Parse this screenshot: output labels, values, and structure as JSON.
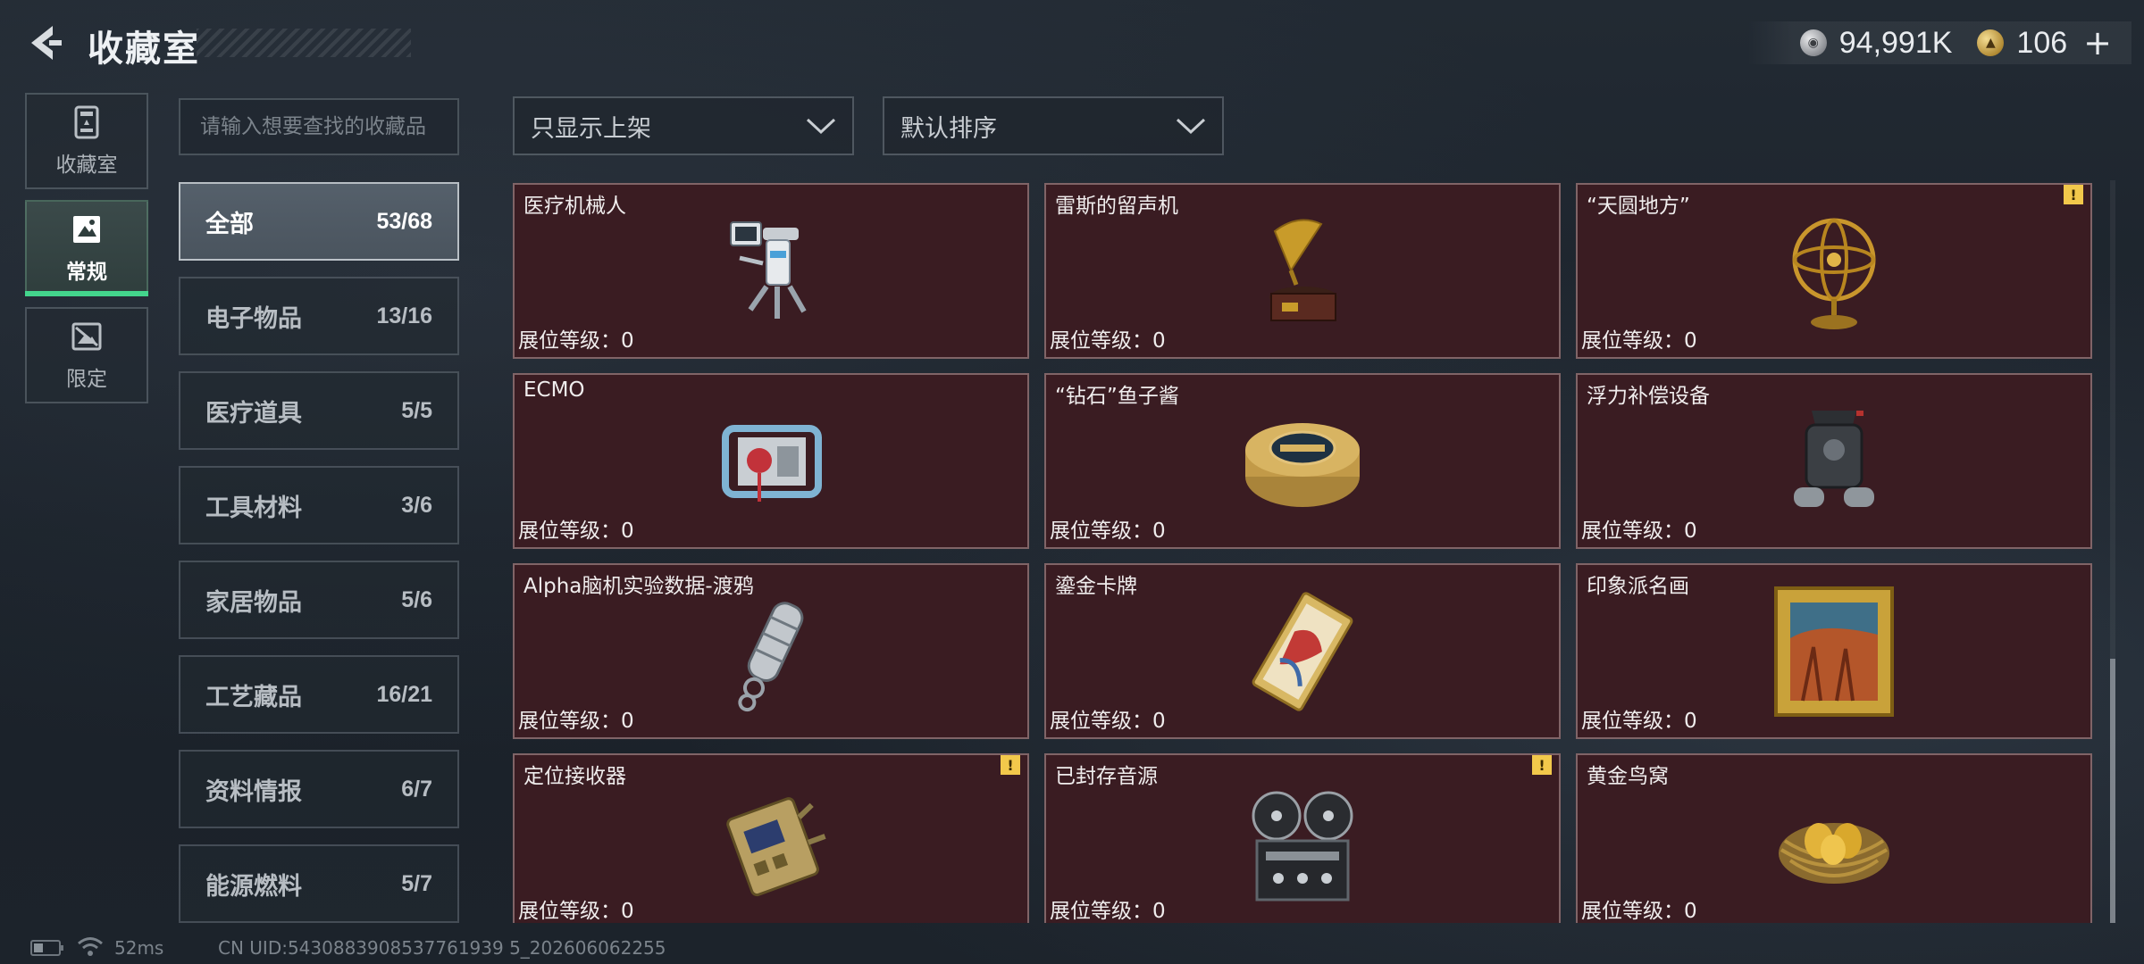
{
  "header": {
    "title": "收藏室",
    "currencies": [
      {
        "icon": "silver-coin-icon",
        "value": "94,991K"
      },
      {
        "icon": "gold-coin-icon",
        "value": "106"
      }
    ],
    "add_label": "+"
  },
  "left_nav": [
    {
      "label": "收藏室",
      "icon": "collection-room-icon",
      "active": false
    },
    {
      "label": "常规",
      "icon": "regular-items-icon",
      "active": true
    },
    {
      "label": "限定",
      "icon": "limited-items-icon",
      "active": false
    }
  ],
  "search": {
    "placeholder": "请输入想要查找的收藏品"
  },
  "categories": [
    {
      "name": "全部",
      "count": "53/68",
      "active": true
    },
    {
      "name": "电子物品",
      "count": "13/16"
    },
    {
      "name": "医疗道具",
      "count": "5/5"
    },
    {
      "name": "工具材料",
      "count": "3/6"
    },
    {
      "name": "家居物品",
      "count": "5/6"
    },
    {
      "name": "工艺藏品",
      "count": "16/21"
    },
    {
      "name": "资料情报",
      "count": "6/7"
    },
    {
      "name": "能源燃料",
      "count": "5/7"
    }
  ],
  "filters": {
    "shelf_filter": "只显示上架",
    "sort": "默认排序"
  },
  "level_label": "展位等级：0",
  "items": [
    {
      "name": "",
      "icon": "item-icon",
      "warn": false
    },
    {
      "name": "",
      "icon": "item-icon",
      "warn": false
    },
    {
      "name": "",
      "icon": "item-icon",
      "warn": false
    },
    {
      "name": "医疗机械人",
      "icon": "medical-robot-icon",
      "warn": false
    },
    {
      "name": "雷斯的留声机",
      "icon": "gramophone-icon",
      "warn": false
    },
    {
      "name": "“天圆地方”",
      "icon": "armillary-sphere-icon",
      "warn": true
    },
    {
      "name": "ECMO",
      "icon": "ecmo-machine-icon",
      "warn": false
    },
    {
      "name": "“钻石”鱼子酱",
      "icon": "caviar-tin-icon",
      "warn": false
    },
    {
      "name": "浮力补偿设备",
      "icon": "buoyancy-device-icon",
      "warn": false
    },
    {
      "name": "Alpha脑机实验数据-渡鸦",
      "icon": "data-drive-icon",
      "warn": false
    },
    {
      "name": "鎏金卡牌",
      "icon": "gilded-card-icon",
      "warn": false
    },
    {
      "name": "印象派名画",
      "icon": "framed-painting-icon",
      "warn": false
    },
    {
      "name": "定位接收器",
      "icon": "locator-receiver-icon",
      "warn": true
    },
    {
      "name": "已封存音源",
      "icon": "reel-to-reel-icon",
      "warn": true
    },
    {
      "name": "黄金鸟窝",
      "icon": "golden-nest-icon",
      "warn": false
    }
  ],
  "footer": {
    "ping": "52ms",
    "uid": "CN UID:5430883908537761939 5_202606062255"
  },
  "colors": {
    "accent_green": "#43d58c",
    "card_bg": "#3a1c22",
    "warn_yellow": "#f2c84b"
  }
}
